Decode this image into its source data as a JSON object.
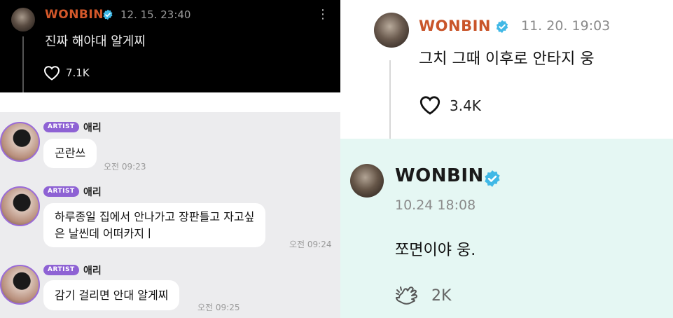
{
  "colors": {
    "name_dark": "#d4582a",
    "name_light": "#c9552a",
    "verified": "#40b8e6",
    "artist_badge": "#8e62d4",
    "dark_bg": "#000000",
    "chat_bg": "#ececee",
    "mint_bg": "#e5f7f3"
  },
  "post_dark": {
    "author": "WONBIN",
    "timestamp": "12. 15. 23:40",
    "text": "진짜 해야대 알게찌",
    "likes": "7.1K",
    "more_icon": "more-vertical-icon"
  },
  "chat": {
    "messages": [
      {
        "badge": "ARTIST",
        "sender": "애리",
        "text": "곤란쓰",
        "time": "오전 09:23"
      },
      {
        "badge": "ARTIST",
        "sender": "애리",
        "text_line1": "하루종일 집에서 안나가고 장판틀고 자고싶",
        "text_line2": "은 날씬데 어떠카지ㅣ",
        "time": "오전 09:24"
      },
      {
        "badge": "ARTIST",
        "sender": "애리",
        "text": "감기 걸리면 안대 알게찌",
        "time": "오전 09:25"
      }
    ]
  },
  "post_light": {
    "author": "WONBIN",
    "timestamp": "11. 20. 19:03",
    "text": "그치 그때 이후로 안타지 웅",
    "likes": "3.4K"
  },
  "post_mint": {
    "author": "WONBIN",
    "timestamp": "10.24 18:08",
    "text": "쪼면이야 웅.",
    "likes": "2K",
    "reaction_icon": "reaction-hand-icon"
  }
}
